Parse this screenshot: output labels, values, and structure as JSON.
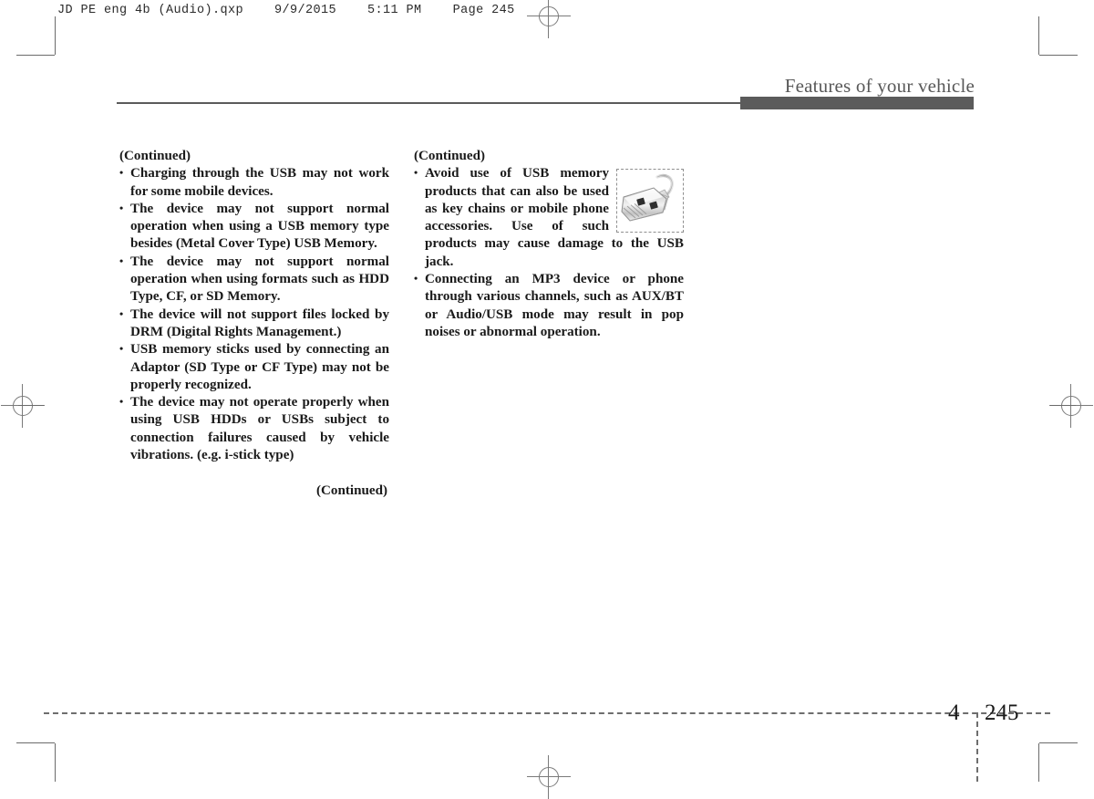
{
  "prepress": {
    "slug": "JD PE eng 4b (Audio).qxp    9/9/2015    5:11 PM    Page 245"
  },
  "header": {
    "running_head": "Features of your vehicle"
  },
  "columns": {
    "left": {
      "continued_label": "(Continued)",
      "bullets": [
        "Charging through the USB may not work for some mobile devices.",
        "The device may not support normal operation when using a USB memory type besides (Metal Cover Type) USB Memory.",
        "The device may not support normal operation when using formats such as HDD Type, CF, or SD Memory.",
        "The device will not support files locked by DRM (Digital Rights Management.)",
        "USB memory sticks used by connecting an Adaptor (SD Type or CF Type) may not be properly recognized.",
        "The device may not operate properly when using USB HDDs or USBs subject to connection failures caused by vehicle vibrations. (e.g. i-stick type)"
      ],
      "continued_footer": "(Continued)"
    },
    "right": {
      "continued_label": "(Continued)",
      "bullets": [
        "Avoid use of USB memory products that can also be used as key chains or mobile phone accessories. Use of such products may cause damage to the USB jack.",
        "Connecting an MP3 device or phone through various channels, such as AUX/BT or Audio/USB mode may result in pop noises or abnormal operation."
      ],
      "illustration": {
        "name": "usb-flash-drive-illustration",
        "alt": "USB memory stick with key chain loop"
      }
    }
  },
  "footer": {
    "chapter_number": "4",
    "page_number": "245"
  },
  "colors": {
    "rule": "#5b5b5b",
    "running_head": "#585858",
    "crop_marks": "#6b6b6b",
    "text": "#1a1a1a"
  }
}
